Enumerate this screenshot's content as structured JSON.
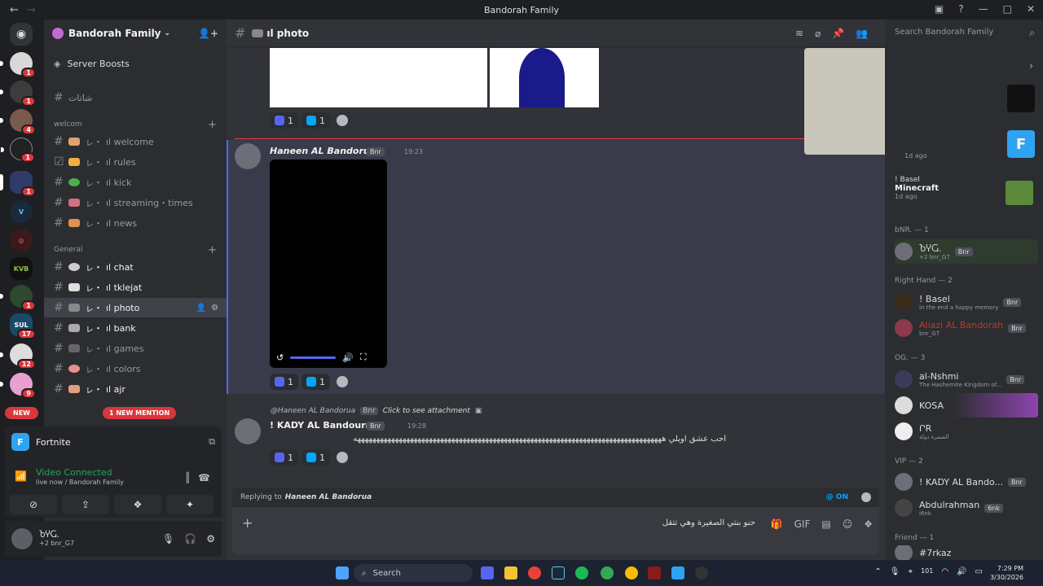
{
  "window": {
    "title": "Bandorah Family",
    "back": "←",
    "forward": "→"
  },
  "server_rail": {
    "badges": [
      "1",
      "1",
      "4",
      "1",
      "1",
      "1",
      "17",
      "12",
      "9"
    ],
    "new_label": "NEW"
  },
  "guild": {
    "name": "Bandorah Family",
    "boosts": "Server Boosts"
  },
  "channels": {
    "top": {
      "name": "شاتات"
    },
    "categories": [
      {
        "name": "welcom"
      },
      {
        "name": "General"
      }
    ],
    "welcom": [
      {
        "prefix": "ㇾ・",
        "name": "ıl welcome"
      },
      {
        "prefix": "ㇾ・",
        "name": "ıl rules"
      },
      {
        "prefix": "ㇾ・",
        "name": "ıl kick"
      },
      {
        "prefix": "ㇾ・",
        "name": "ıl streaming・times"
      },
      {
        "prefix": "ㇾ・",
        "name": "ıl news"
      }
    ],
    "general": [
      {
        "prefix": "ㇾ・",
        "name": "ıl chat"
      },
      {
        "prefix": "ㇾ・",
        "name": "ıl tklejat"
      },
      {
        "prefix": "ㇾ・",
        "name": "ıl photo"
      },
      {
        "prefix": "ㇾ・",
        "name": "ıl bank"
      },
      {
        "prefix": "ㇾ・",
        "name": "ıl games"
      },
      {
        "prefix": "ㇾ・",
        "name": "ıl colors"
      },
      {
        "prefix": "ㇾ・",
        "name": "ıl ajr"
      }
    ],
    "mention_pill": "1 NEW MENTION"
  },
  "voice_panel": {
    "game": "Fortnite",
    "status": "Video Connected",
    "sub": "live now / Bandorah Family"
  },
  "user_panel": {
    "name": "ႦჄႺ.",
    "status": "bnr_G7",
    "count": "+2"
  },
  "topbar": {
    "channel": "ıl photo",
    "search_placeholder": "Search Bandorah Family"
  },
  "messages": [
    {
      "reactions": [
        "1",
        "1"
      ]
    },
    {
      "author": "Haneen AL Bandorua",
      "tag": "Bnr",
      "time": "19:23",
      "reactions": [
        "1",
        "1"
      ]
    },
    {
      "reply_to": "@Haneen AL Bandorua",
      "reply_tag": "Bnr",
      "reply_text": "Click to see attachment",
      "author": "! KADY AL Bandoura",
      "tag": "Bnr",
      "time": "19:28",
      "text": "احب عشق اويلي ههههههههههههههههههههههههههههههههههههههههههههههههههههههههههههههههههههههههههههههههههه",
      "reactions": [
        "1",
        "1"
      ]
    }
  ],
  "composer": {
    "replying_label": "Replying to",
    "replying_to": "Haneen AL Bandorua",
    "mention_toggle": "@ ON",
    "draft": "حنو بنتي الصغيرة وهي تتقل"
  },
  "members": {
    "game_cards": [
      {
        "time": "1d ago"
      },
      {
        "user": "! Basel",
        "game": "Minecraft",
        "time": "1d ago"
      }
    ],
    "groups": [
      {
        "title": "bNR. — 1",
        "members": [
          {
            "name": "ႦჄႺ.",
            "tag": "Bnr",
            "status": "bnr_G7",
            "count": "+2"
          }
        ]
      },
      {
        "title": "Right Hand — 2",
        "members": [
          {
            "name": "! Basel",
            "tag": "Bnr",
            "status": "in the end a happy memory"
          },
          {
            "name": "Aliazi AL Bandorah",
            "tag": "Bnr",
            "status": "bnr_G7"
          }
        ]
      },
      {
        "title": "OG. — 3",
        "members": [
          {
            "name": "al-Nshmi",
            "tag": "Bnr",
            "status": "The Hashemite Kingdom of..."
          },
          {
            "name": "KOSA",
            "status": ""
          },
          {
            "name": "ՐR",
            "status": "الصمرة دولة"
          }
        ]
      },
      {
        "title": "VIP — 2",
        "members": [
          {
            "name": "! KADY AL Bando...",
            "tag": "Bnr",
            "status": ""
          },
          {
            "name": "Abdulrahman",
            "tag": "6nk",
            "status": "i6nk"
          }
        ]
      },
      {
        "title": "Friend — 1",
        "members": [
          {
            "name": "#7rkaz",
            "status": ""
          }
        ]
      }
    ]
  },
  "taskbar": {
    "search": "Search",
    "time": "7:29 PM",
    "date": "3/30/2026",
    "count": "101"
  },
  "colors": {
    "accent": "#5865f2",
    "danger": "#da373c",
    "online": "#23a55a"
  }
}
